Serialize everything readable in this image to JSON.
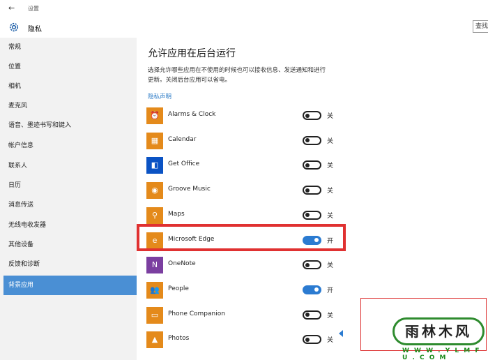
{
  "window": {
    "title": "设置"
  },
  "header": {
    "title": "隐私",
    "search_placeholder": "查找"
  },
  "sidebar": {
    "items": [
      {
        "label": "常规"
      },
      {
        "label": "位置"
      },
      {
        "label": "相机"
      },
      {
        "label": "麦克风"
      },
      {
        "label": "语音、墨迹书写和键入"
      },
      {
        "label": "帐户信息"
      },
      {
        "label": "联系人"
      },
      {
        "label": "日历"
      },
      {
        "label": "消息传送"
      },
      {
        "label": "无线电收发器"
      },
      {
        "label": "其他设备"
      },
      {
        "label": "反馈和诊断"
      },
      {
        "label": "背景应用"
      }
    ],
    "active_index": 12
  },
  "main": {
    "title": "允许应用在后台运行",
    "description": "选择允许哪些应用在不使用的时候也可以接收信息、发送通知和进行更新。关闭后台应用可以省电。",
    "privacy_link": "隐私声明",
    "apps": [
      {
        "name": "Alarms & Clock",
        "state": "关",
        "on": false,
        "icon": "alarm-clock-icon",
        "glyph": "⏰"
      },
      {
        "name": "Calendar",
        "state": "关",
        "on": false,
        "icon": "calendar-icon",
        "glyph": "▦"
      },
      {
        "name": "Get Office",
        "state": "关",
        "on": false,
        "icon": "office-icon",
        "glyph": "◧"
      },
      {
        "name": "Groove Music",
        "state": "关",
        "on": false,
        "icon": "music-icon",
        "glyph": "◉"
      },
      {
        "name": "Maps",
        "state": "关",
        "on": false,
        "icon": "maps-icon",
        "glyph": "⚲"
      },
      {
        "name": "Microsoft Edge",
        "state": "开",
        "on": true,
        "icon": "edge-icon",
        "glyph": "e"
      },
      {
        "name": "OneNote",
        "state": "关",
        "on": false,
        "icon": "onenote-icon",
        "glyph": "N"
      },
      {
        "name": "People",
        "state": "开",
        "on": true,
        "icon": "people-icon",
        "glyph": "👥"
      },
      {
        "name": "Phone Companion",
        "state": "关",
        "on": false,
        "icon": "phone-companion-icon",
        "glyph": "▭"
      },
      {
        "name": "Photos",
        "state": "关",
        "on": false,
        "icon": "photos-icon",
        "glyph": "▲"
      }
    ]
  },
  "watermark": {
    "text": "雨林木风",
    "url": "W W W . Y L M F U . C O M"
  },
  "colors": {
    "accent": "#2b7bd1",
    "sidebar_active": "#4a8fd4",
    "app_tile": "#e48a1b",
    "highlight": "#e03131"
  }
}
